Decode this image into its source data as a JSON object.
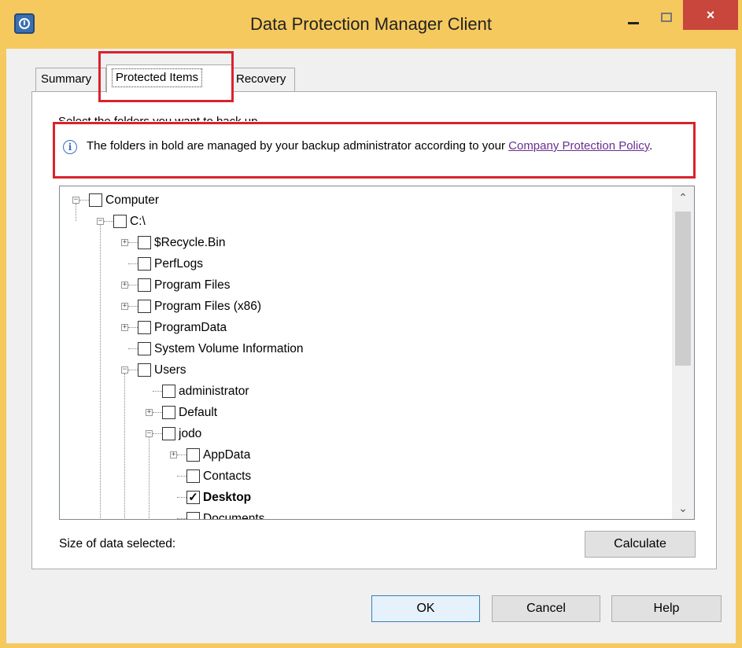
{
  "window": {
    "title": "Data Protection Manager Client",
    "close_glyph": "×",
    "accent_color": "#f5c95e",
    "close_color": "#c8463b"
  },
  "tabs": [
    {
      "label": "Summary",
      "selected": false
    },
    {
      "label": "Protected Items",
      "selected": true
    },
    {
      "label": "Recovery",
      "selected": false
    }
  ],
  "panel": {
    "instruction": "Select the folders you want to back up",
    "info_text": "The folders in bold are managed by your backup administrator according to your ",
    "info_link": "Company Protection Policy",
    "info_suffix": ".",
    "info_icon_glyph": "i"
  },
  "tree": {
    "nodes": [
      {
        "label": "Computer",
        "expander": "−",
        "checked": ""
      },
      {
        "label": "C:\\",
        "expander": "−",
        "checked": ""
      },
      {
        "label": "$Recycle.Bin",
        "expander": "+",
        "checked": ""
      },
      {
        "label": "PerfLogs",
        "expander": "",
        "checked": ""
      },
      {
        "label": "Program Files",
        "expander": "+",
        "checked": ""
      },
      {
        "label": "Program Files (x86)",
        "expander": "+",
        "checked": ""
      },
      {
        "label": "ProgramData",
        "expander": "+",
        "checked": ""
      },
      {
        "label": "System Volume Information",
        "expander": "",
        "checked": ""
      },
      {
        "label": "Users",
        "expander": "−",
        "checked": ""
      },
      {
        "label": "administrator",
        "expander": "",
        "checked": ""
      },
      {
        "label": "Default",
        "expander": "+",
        "checked": ""
      },
      {
        "label": "jodo",
        "expander": "−",
        "checked": ""
      },
      {
        "label": "AppData",
        "expander": "+",
        "checked": ""
      },
      {
        "label": "Contacts",
        "expander": "",
        "checked": ""
      },
      {
        "label": "Desktop",
        "expander": "",
        "checked": "✓",
        "bold": true
      },
      {
        "label": "Documents",
        "expander": "",
        "checked": ""
      }
    ],
    "scroll_up": "⌃",
    "scroll_down": "⌄"
  },
  "footer": {
    "size_label": "Size of data selected:",
    "calculate": "Calculate",
    "ok": "OK",
    "cancel": "Cancel",
    "help": "Help"
  }
}
